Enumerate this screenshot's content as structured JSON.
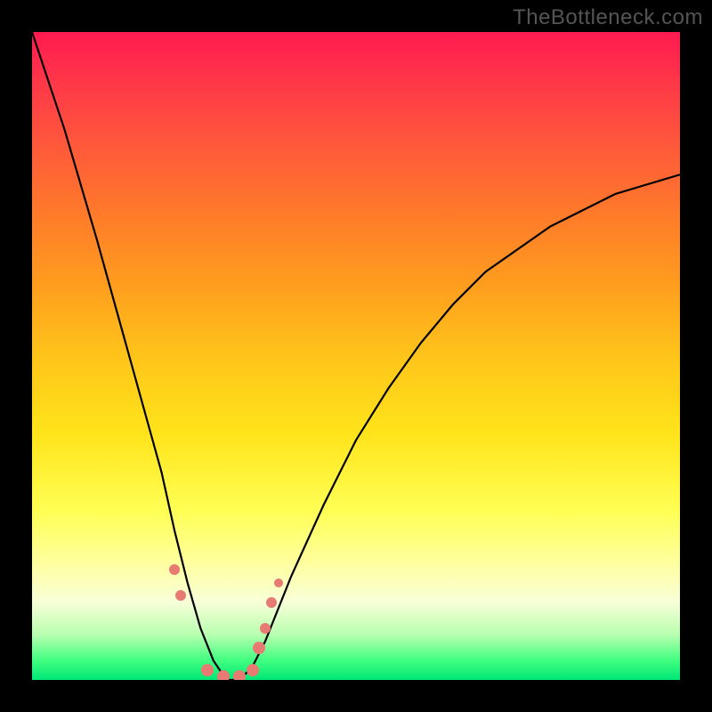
{
  "watermark": "TheBottleneck.com",
  "colors": {
    "background": "#000000",
    "gradient_top": "#ff1a50",
    "gradient_mid": "#ffe41a",
    "gradient_bottom": "#00e676",
    "curve": "#000000",
    "beads": "#e77a72"
  },
  "chart_data": {
    "type": "line",
    "title": "",
    "xlabel": "",
    "ylabel": "",
    "xlim": [
      0,
      100
    ],
    "ylim": [
      0,
      100
    ],
    "series": [
      {
        "name": "bottleneck-curve",
        "x": [
          0,
          5,
          10,
          15,
          20,
          22,
          24,
          26,
          28,
          30,
          32,
          34,
          36,
          40,
          45,
          50,
          55,
          60,
          65,
          70,
          80,
          90,
          100
        ],
        "y": [
          100,
          85,
          68,
          50,
          32,
          23,
          15,
          8,
          3,
          0,
          0,
          2,
          6,
          16,
          27,
          37,
          45,
          52,
          58,
          63,
          70,
          75,
          78
        ]
      }
    ],
    "markers": [
      {
        "name": "bead",
        "x": 22,
        "y": 17,
        "size": 12
      },
      {
        "name": "bead",
        "x": 23,
        "y": 13,
        "size": 12
      },
      {
        "name": "bead",
        "x": 27,
        "y": 1.5,
        "size": 14
      },
      {
        "name": "bead",
        "x": 29.5,
        "y": 0.5,
        "size": 14
      },
      {
        "name": "bead",
        "x": 32,
        "y": 0.5,
        "size": 14
      },
      {
        "name": "bead",
        "x": 34,
        "y": 1.5,
        "size": 14
      },
      {
        "name": "bead",
        "x": 35,
        "y": 5,
        "size": 14
      },
      {
        "name": "bead",
        "x": 36,
        "y": 8,
        "size": 12
      },
      {
        "name": "bead",
        "x": 37,
        "y": 12,
        "size": 12
      },
      {
        "name": "bead",
        "x": 38,
        "y": 15,
        "size": 10
      }
    ]
  }
}
